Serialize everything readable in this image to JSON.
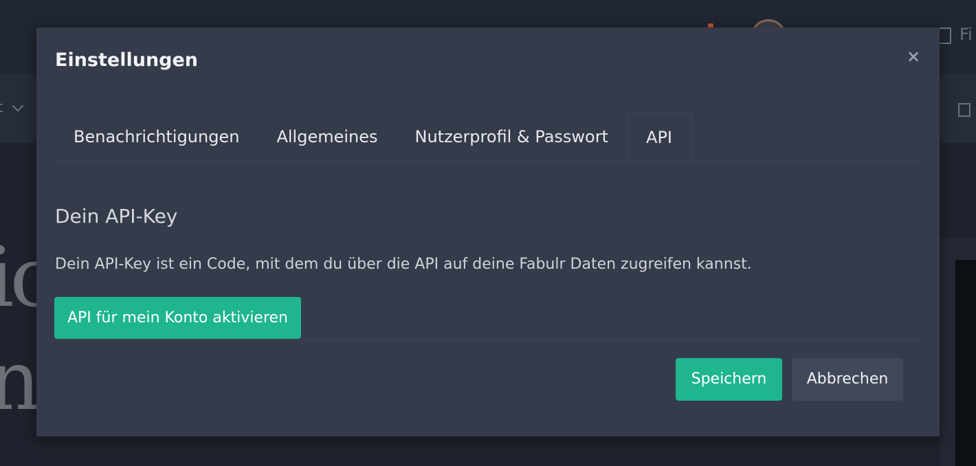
{
  "background": {
    "nav_fragment": "t",
    "headline_fragment": "ic\nne",
    "right_fragment": "Fi"
  },
  "modal": {
    "title": "Einstellungen",
    "close_label": "×",
    "tabs": [
      {
        "label": "Benachrichtigungen",
        "active": false
      },
      {
        "label": "Allgemeines",
        "active": false
      },
      {
        "label": "Nutzerprofil & Passwort",
        "active": false
      },
      {
        "label": "API",
        "active": true
      }
    ],
    "section_title": "Dein API-Key",
    "section_description": "Dein API-Key ist ein Code, mit dem du über die API auf deine Fabulr Daten zugreifen kannst.",
    "activate_button": "API für mein Konto aktivieren",
    "save_button": "Speichern",
    "cancel_button": "Abbrechen"
  },
  "colors": {
    "accent": "#1fb58f",
    "modal_bg": "#353b4b",
    "backdrop": "#1f2430"
  }
}
